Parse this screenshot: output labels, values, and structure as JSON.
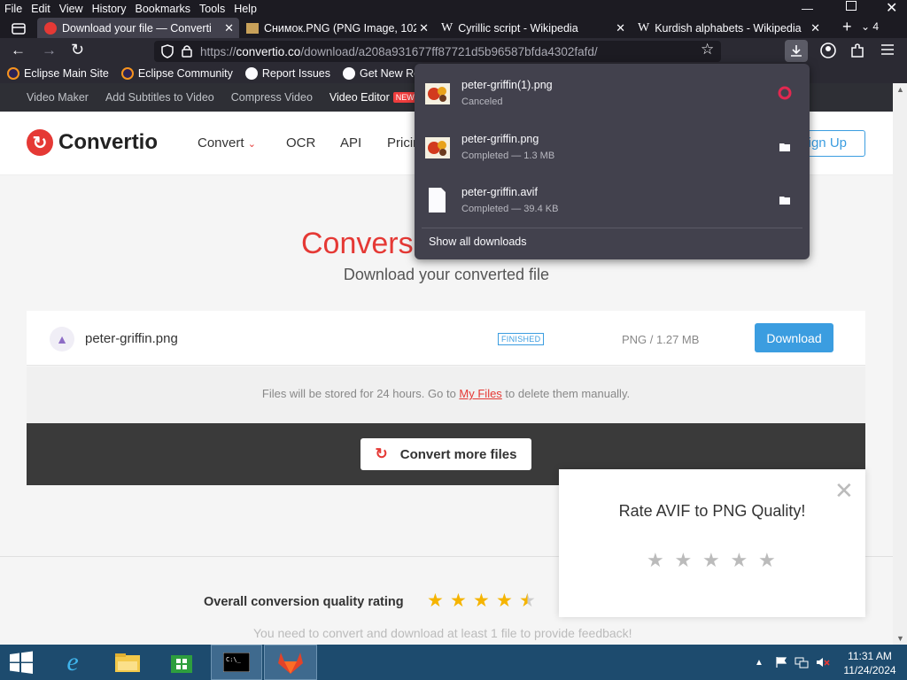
{
  "menubar": {
    "items": [
      {
        "key": "F",
        "rest": "ile"
      },
      {
        "key": "E",
        "rest": "dit"
      },
      {
        "key": "V",
        "rest": "iew"
      },
      {
        "key": "",
        "rest": "History",
        "u": "s"
      },
      {
        "key": "B",
        "rest": "ookmarks"
      },
      {
        "key": "T",
        "rest": "ools"
      },
      {
        "key": "H",
        "rest": "elp"
      }
    ],
    "labels": [
      "File",
      "Edit",
      "View",
      "History",
      "Bookmarks",
      "Tools",
      "Help"
    ]
  },
  "tabs": [
    {
      "title": "Download your file — Converti"
    },
    {
      "title": "Снимок.PNG (PNG Image, 102("
    },
    {
      "title": "Cyrillic script - Wikipedia"
    },
    {
      "title": "Kurdish alphabets - Wikipedia"
    }
  ],
  "tab_count": "4",
  "url": {
    "prefix": "https://",
    "host": "convertio.co",
    "path": "/download/a208a931677ff87721d5b96587bfda4302fafd/"
  },
  "bookmarks": [
    "Eclipse Main Site",
    "Eclipse Community",
    "Report Issues",
    "Get New Releases"
  ],
  "sitebar": {
    "links": [
      "Video Maker",
      "Add Subtitles to Video",
      "Compress Video",
      "Video Editor"
    ],
    "new_badge": "NEW"
  },
  "header": {
    "brand": "Convertio",
    "nav": [
      "Convert",
      "OCR",
      "API",
      "Pricin"
    ],
    "signup": "Sign Up"
  },
  "main": {
    "title": "Conversi",
    "subtitle": "Download your converted file",
    "file": {
      "name": "peter-griffin.png",
      "status": "FINISHED",
      "size": "PNG / 1.27 MB",
      "download": "Download"
    },
    "store_note_pre": "Files will be stored for 24 hours. Go to ",
    "store_note_link": "My Files",
    "store_note_post": " to delete them manually.",
    "convert_more": "Convert more files",
    "overall_label": "Overall conversion quality rating",
    "overall_rating": 4.5,
    "need_convert": "You need to convert and download at least 1 file to provide feedback!"
  },
  "rate_popup": {
    "title": "Rate AVIF to PNG Quality!",
    "stars": 5
  },
  "downloads_panel": {
    "items": [
      {
        "name": "peter-griffin(1).png",
        "status": "Canceled",
        "action": "retry"
      },
      {
        "name": "peter-griffin.png",
        "status": "Completed — 1.3 MB",
        "action": "folder"
      },
      {
        "name": "peter-griffin.avif",
        "status": "Completed — 39.4 KB",
        "action": "folder"
      }
    ],
    "show_all": "Show all downloads"
  },
  "taskbar": {
    "time": "11:31 AM",
    "date": "11/24/2024"
  },
  "colors": {
    "brand_red": "#e53935",
    "accent_blue": "#3b9de0",
    "firefox_dark": "#1c1b22"
  }
}
